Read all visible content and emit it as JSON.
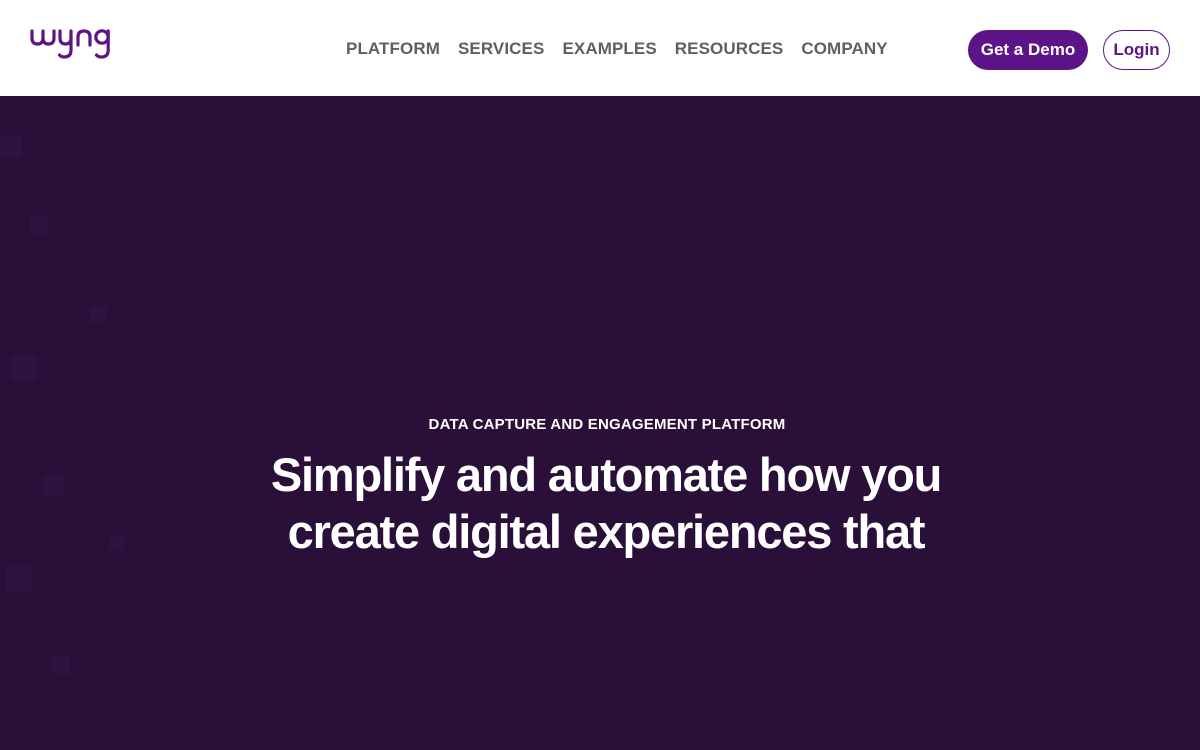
{
  "header": {
    "logo_text": "wyng",
    "nav": [
      {
        "label": "PLATFORM"
      },
      {
        "label": "SERVICES"
      },
      {
        "label": "EXAMPLES"
      },
      {
        "label": "RESOURCES"
      },
      {
        "label": "COMPANY"
      }
    ],
    "demo_button": "Get a Demo",
    "login_button": "Login"
  },
  "hero": {
    "eyebrow": "DATA CAPTURE AND ENGAGEMENT PLATFORM",
    "headline": "Simplify and automate how you\ncreate digital experiences that"
  },
  "colors": {
    "brand_purple": "#5c1488",
    "hero_background": "#2a0f38",
    "nav_text": "#5f5f63",
    "white": "#ffffff"
  }
}
